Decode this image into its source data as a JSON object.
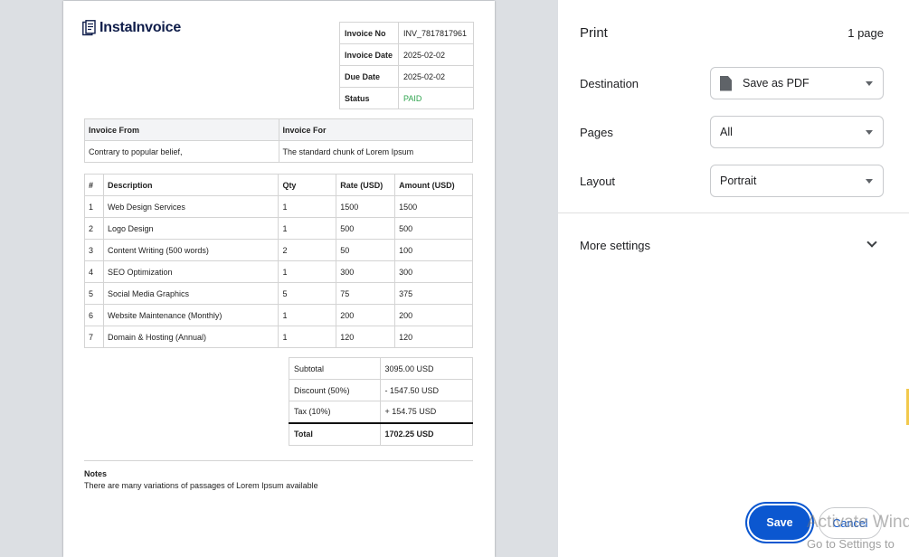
{
  "invoice": {
    "brand": "InstaInvoice",
    "meta": [
      {
        "label": "Invoice No",
        "value": "INV_7817817961"
      },
      {
        "label": "Invoice Date",
        "value": "2025-02-02"
      },
      {
        "label": "Due Date",
        "value": "2025-02-02"
      },
      {
        "label": "Status",
        "value": "PAID"
      }
    ],
    "parties": {
      "from_header": "Invoice From",
      "for_header": "Invoice For",
      "from_value": "Contrary to popular belief,",
      "for_value": "The standard chunk of Lorem Ipsum"
    },
    "items_headers": [
      "#",
      "Description",
      "Qty",
      "Rate (USD)",
      "Amount (USD)"
    ],
    "items": [
      [
        "1",
        "Web Design Services",
        "1",
        "1500",
        "1500"
      ],
      [
        "2",
        "Logo Design",
        "1",
        "500",
        "500"
      ],
      [
        "3",
        "Content Writing (500 words)",
        "2",
        "50",
        "100"
      ],
      [
        "4",
        "SEO Optimization",
        "1",
        "300",
        "300"
      ],
      [
        "5",
        "Social Media Graphics",
        "5",
        "75",
        "375"
      ],
      [
        "6",
        "Website Maintenance (Monthly)",
        "1",
        "200",
        "200"
      ],
      [
        "7",
        "Domain & Hosting (Annual)",
        "1",
        "120",
        "120"
      ]
    ],
    "totals": [
      {
        "label": "Subtotal",
        "value": "3095.00 USD"
      },
      {
        "label": "Discount (50%)",
        "value": "- 1547.50 USD"
      },
      {
        "label": "Tax (10%)",
        "value": "+ 154.75 USD"
      },
      {
        "label": "Total",
        "value": "1702.25 USD"
      }
    ],
    "notes_title": "Notes",
    "notes_text": "There are many variations of passages of Lorem Ipsum available"
  },
  "print": {
    "title": "Print",
    "page_count": "1 page",
    "destination_label": "Destination",
    "destination_value": "Save as PDF",
    "pages_label": "Pages",
    "pages_value": "All",
    "layout_label": "Layout",
    "layout_value": "Portrait",
    "more_settings": "More settings",
    "save": "Save",
    "cancel": "Cancel"
  },
  "watermark": {
    "line1": "Activate Wind",
    "line2": "Go to Settings to"
  },
  "colors": {
    "accent": "#0b57d0",
    "paid": "#2fa44f",
    "brand": "#0f1d4a"
  }
}
